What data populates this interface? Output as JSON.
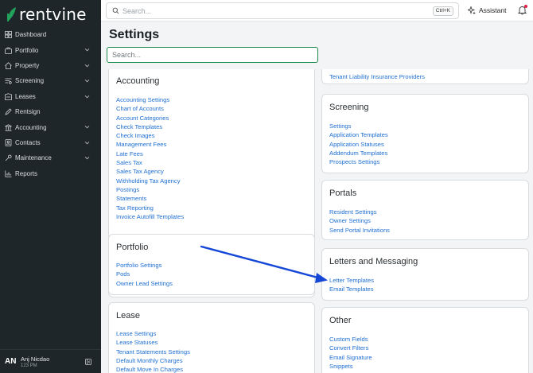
{
  "app": {
    "brand": "rentvine"
  },
  "sidebar": {
    "items": [
      {
        "label": "Dashboard",
        "icon": "dashboard-icon",
        "chevron": false
      },
      {
        "label": "Portfolio",
        "icon": "portfolio-icon",
        "chevron": true
      },
      {
        "label": "Property",
        "icon": "property-icon",
        "chevron": true
      },
      {
        "label": "Screening",
        "icon": "screening-icon",
        "chevron": true
      },
      {
        "label": "Leases",
        "icon": "leases-icon",
        "chevron": true
      },
      {
        "label": "Rentsign",
        "icon": "rentsign-icon",
        "chevron": false
      },
      {
        "label": "Accounting",
        "icon": "accounting-icon",
        "chevron": true
      },
      {
        "label": "Contacts",
        "icon": "contacts-icon",
        "chevron": true
      },
      {
        "label": "Maintenance",
        "icon": "maintenance-icon",
        "chevron": true
      },
      {
        "label": "Reports",
        "icon": "reports-icon",
        "chevron": false
      }
    ],
    "user": {
      "initials": "AN",
      "name": "Anj Nicdao",
      "time": "123 PM"
    }
  },
  "topbar": {
    "search_placeholder": "Search...",
    "shortcut": "Ctrl+K",
    "assistant_label": "Assistant"
  },
  "page": {
    "title": "Settings",
    "search_placeholder": "Search..."
  },
  "cards": {
    "accounting": {
      "title": "Accounting",
      "links": [
        "Accounting Settings",
        "Chart of Accounts",
        "Account Categories",
        "Check Templates",
        "Check Images",
        "Management Fees",
        "Late Fees",
        "Sales Tax",
        "Sales Tax Agency",
        "Withholding Tax Agency",
        "Postings",
        "Statements",
        "Tax Reporting",
        "Invoice Autofill Templates"
      ]
    },
    "portfolio": {
      "title": "Portfolio",
      "links": [
        "Portfolio Settings",
        "Pods",
        "Owner Lead Settings"
      ]
    },
    "lease": {
      "title": "Lease",
      "links": [
        "Lease Settings",
        "Lease Statuses",
        "Tenant Statements Settings",
        "Default Monthly Charges",
        "Default Move In Charges"
      ]
    },
    "insurance": {
      "links": [
        "Tenant Liability Insurance Providers"
      ]
    },
    "screening": {
      "title": "Screening",
      "links": [
        "Settings",
        "Application Templates",
        "Application Statuses",
        "Addendum Templates",
        "Prospects Settings"
      ]
    },
    "portals": {
      "title": "Portals",
      "links": [
        "Resident Settings",
        "Owner Settings",
        "Send Portal Invitations"
      ]
    },
    "letters": {
      "title": "Letters and Messaging",
      "links": [
        "Letter Templates",
        "Email Templates"
      ]
    },
    "other": {
      "title": "Other",
      "links": [
        "Custom Fields",
        "Convert Filters",
        "Email Signature",
        "Snippets"
      ]
    }
  },
  "colors": {
    "sidebar_bg": "#1f2629",
    "link": "#1f6fd1",
    "brand_green": "#22a25a",
    "annotation_arrow": "#1447d6"
  }
}
